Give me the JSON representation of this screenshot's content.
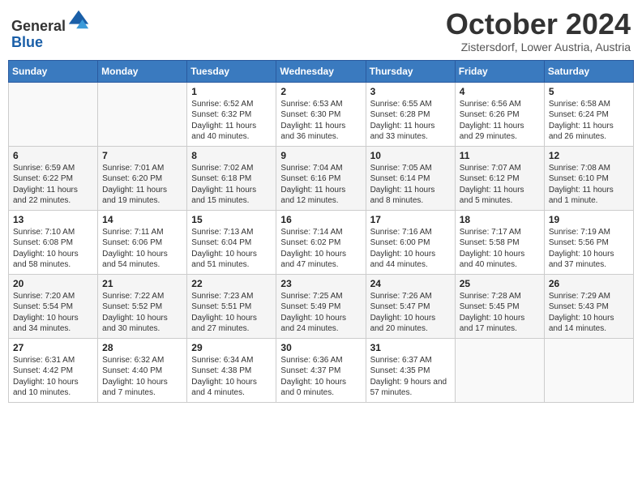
{
  "header": {
    "logo_line1": "General",
    "logo_line2": "Blue",
    "month": "October 2024",
    "location": "Zistersdorf, Lower Austria, Austria"
  },
  "days_of_week": [
    "Sunday",
    "Monday",
    "Tuesday",
    "Wednesday",
    "Thursday",
    "Friday",
    "Saturday"
  ],
  "weeks": [
    [
      {
        "day": "",
        "info": ""
      },
      {
        "day": "",
        "info": ""
      },
      {
        "day": "1",
        "info": "Sunrise: 6:52 AM\nSunset: 6:32 PM\nDaylight: 11 hours and 40 minutes."
      },
      {
        "day": "2",
        "info": "Sunrise: 6:53 AM\nSunset: 6:30 PM\nDaylight: 11 hours and 36 minutes."
      },
      {
        "day": "3",
        "info": "Sunrise: 6:55 AM\nSunset: 6:28 PM\nDaylight: 11 hours and 33 minutes."
      },
      {
        "day": "4",
        "info": "Sunrise: 6:56 AM\nSunset: 6:26 PM\nDaylight: 11 hours and 29 minutes."
      },
      {
        "day": "5",
        "info": "Sunrise: 6:58 AM\nSunset: 6:24 PM\nDaylight: 11 hours and 26 minutes."
      }
    ],
    [
      {
        "day": "6",
        "info": "Sunrise: 6:59 AM\nSunset: 6:22 PM\nDaylight: 11 hours and 22 minutes."
      },
      {
        "day": "7",
        "info": "Sunrise: 7:01 AM\nSunset: 6:20 PM\nDaylight: 11 hours and 19 minutes."
      },
      {
        "day": "8",
        "info": "Sunrise: 7:02 AM\nSunset: 6:18 PM\nDaylight: 11 hours and 15 minutes."
      },
      {
        "day": "9",
        "info": "Sunrise: 7:04 AM\nSunset: 6:16 PM\nDaylight: 11 hours and 12 minutes."
      },
      {
        "day": "10",
        "info": "Sunrise: 7:05 AM\nSunset: 6:14 PM\nDaylight: 11 hours and 8 minutes."
      },
      {
        "day": "11",
        "info": "Sunrise: 7:07 AM\nSunset: 6:12 PM\nDaylight: 11 hours and 5 minutes."
      },
      {
        "day": "12",
        "info": "Sunrise: 7:08 AM\nSunset: 6:10 PM\nDaylight: 11 hours and 1 minute."
      }
    ],
    [
      {
        "day": "13",
        "info": "Sunrise: 7:10 AM\nSunset: 6:08 PM\nDaylight: 10 hours and 58 minutes."
      },
      {
        "day": "14",
        "info": "Sunrise: 7:11 AM\nSunset: 6:06 PM\nDaylight: 10 hours and 54 minutes."
      },
      {
        "day": "15",
        "info": "Sunrise: 7:13 AM\nSunset: 6:04 PM\nDaylight: 10 hours and 51 minutes."
      },
      {
        "day": "16",
        "info": "Sunrise: 7:14 AM\nSunset: 6:02 PM\nDaylight: 10 hours and 47 minutes."
      },
      {
        "day": "17",
        "info": "Sunrise: 7:16 AM\nSunset: 6:00 PM\nDaylight: 10 hours and 44 minutes."
      },
      {
        "day": "18",
        "info": "Sunrise: 7:17 AM\nSunset: 5:58 PM\nDaylight: 10 hours and 40 minutes."
      },
      {
        "day": "19",
        "info": "Sunrise: 7:19 AM\nSunset: 5:56 PM\nDaylight: 10 hours and 37 minutes."
      }
    ],
    [
      {
        "day": "20",
        "info": "Sunrise: 7:20 AM\nSunset: 5:54 PM\nDaylight: 10 hours and 34 minutes."
      },
      {
        "day": "21",
        "info": "Sunrise: 7:22 AM\nSunset: 5:52 PM\nDaylight: 10 hours and 30 minutes."
      },
      {
        "day": "22",
        "info": "Sunrise: 7:23 AM\nSunset: 5:51 PM\nDaylight: 10 hours and 27 minutes."
      },
      {
        "day": "23",
        "info": "Sunrise: 7:25 AM\nSunset: 5:49 PM\nDaylight: 10 hours and 24 minutes."
      },
      {
        "day": "24",
        "info": "Sunrise: 7:26 AM\nSunset: 5:47 PM\nDaylight: 10 hours and 20 minutes."
      },
      {
        "day": "25",
        "info": "Sunrise: 7:28 AM\nSunset: 5:45 PM\nDaylight: 10 hours and 17 minutes."
      },
      {
        "day": "26",
        "info": "Sunrise: 7:29 AM\nSunset: 5:43 PM\nDaylight: 10 hours and 14 minutes."
      }
    ],
    [
      {
        "day": "27",
        "info": "Sunrise: 6:31 AM\nSunset: 4:42 PM\nDaylight: 10 hours and 10 minutes."
      },
      {
        "day": "28",
        "info": "Sunrise: 6:32 AM\nSunset: 4:40 PM\nDaylight: 10 hours and 7 minutes."
      },
      {
        "day": "29",
        "info": "Sunrise: 6:34 AM\nSunset: 4:38 PM\nDaylight: 10 hours and 4 minutes."
      },
      {
        "day": "30",
        "info": "Sunrise: 6:36 AM\nSunset: 4:37 PM\nDaylight: 10 hours and 0 minutes."
      },
      {
        "day": "31",
        "info": "Sunrise: 6:37 AM\nSunset: 4:35 PM\nDaylight: 9 hours and 57 minutes."
      },
      {
        "day": "",
        "info": ""
      },
      {
        "day": "",
        "info": ""
      }
    ]
  ]
}
